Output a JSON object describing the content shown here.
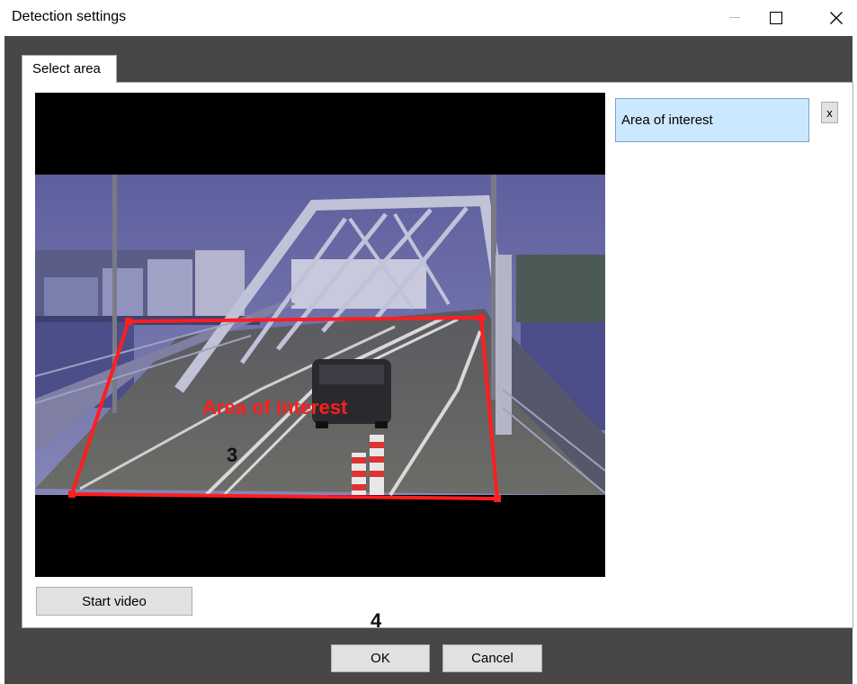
{
  "window": {
    "title": "Detection settings",
    "minimize_glyph": "—",
    "maximize_glyph": "☐",
    "close_glyph": "✕"
  },
  "tabs": [
    {
      "label": "Select area",
      "selected": true
    }
  ],
  "video": {
    "area_label": "Area of interest",
    "area_color": "#ff1e1e",
    "callout_number": "3"
  },
  "areas_list": {
    "items": [
      {
        "label": "Area of interest",
        "selected": true
      }
    ],
    "remove_label": "x"
  },
  "buttons": {
    "start_video": "Start video",
    "ok": "OK",
    "cancel": "Cancel"
  },
  "callouts": {
    "step_ok": "4"
  }
}
